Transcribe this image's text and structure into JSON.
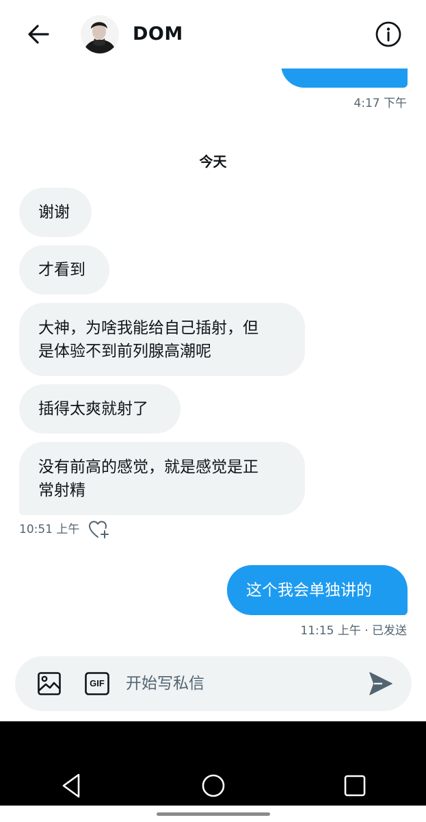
{
  "header": {
    "contact_name": "DOM",
    "back_icon": "arrow-left-icon",
    "info_icon": "info-icon"
  },
  "messages": {
    "partial_out_time": "4:17 下午",
    "day_separator": "今天",
    "incoming": [
      "谢谢",
      "才看到",
      "大神，为啥我能给自己插射，但\n是体验不到前列腺高潮呢",
      "插得太爽就射了",
      "没有前高的感觉，就是感觉是正\n常射精"
    ],
    "incoming_time": "10:51 上午",
    "outgoing": "这个我会单独讲的",
    "outgoing_status": "11:15 上午 · 已发送"
  },
  "composer": {
    "placeholder": "开始写私信",
    "image_icon": "image-icon",
    "gif_icon": "gif-icon",
    "send_icon": "send-icon",
    "gif_label": "GIF"
  },
  "colors": {
    "accent": "#1d9bf0",
    "incoming_bubble": "#eff3f4",
    "meta_text": "#536471"
  }
}
